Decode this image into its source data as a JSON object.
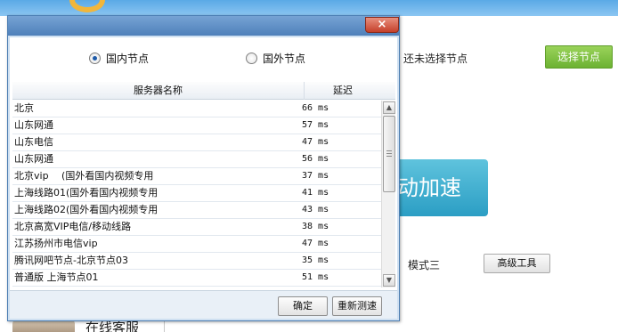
{
  "background": {
    "status_text": "还未选择节点",
    "select_node_label": "选择节点",
    "accelerate_label": "动加速",
    "mode_label": "模式三",
    "advanced_tools_label": "高级工具",
    "customer_service_label": "在线客服"
  },
  "dialog": {
    "close_label": "×",
    "radio_options": [
      {
        "label": "国内节点",
        "checked": true
      },
      {
        "label": "国外节点",
        "checked": false
      }
    ],
    "columns": {
      "name": "服务器名称",
      "latency": "延迟"
    },
    "rows": [
      {
        "name": "北京",
        "latency": "66 ms"
      },
      {
        "name": "山东网通",
        "latency": "57 ms"
      },
      {
        "name": "山东电信",
        "latency": "47 ms"
      },
      {
        "name": "山东网通",
        "latency": "56 ms"
      },
      {
        "name": "北京vip　 (国外看国内视频专用",
        "latency": "37 ms"
      },
      {
        "name": "上海线路01(国外看国内视频专用",
        "latency": "41 ms"
      },
      {
        "name": "上海线路02(国外看国内视频专用",
        "latency": "43 ms"
      },
      {
        "name": "北京高宽VIP电信/移动线路",
        "latency": "38 ms"
      },
      {
        "name": "江苏扬州市电信vip",
        "latency": "47 ms"
      },
      {
        "name": "腾讯网吧节点-北京节点03",
        "latency": "35 ms"
      },
      {
        "name": "普通版 上海节点01",
        "latency": "51 ms"
      }
    ],
    "ok_label": "确定",
    "retest_label": "重新测速"
  },
  "colors": {
    "title_bar": "#5b8cc4",
    "close_button": "#d0523c",
    "select_button": "#7cbf3f",
    "accelerate_button": "#3aaed3"
  },
  "icons": [
    "close-icon",
    "radio-checked-icon",
    "radio-unchecked-icon",
    "scroll-up-icon",
    "scroll-down-icon"
  ]
}
